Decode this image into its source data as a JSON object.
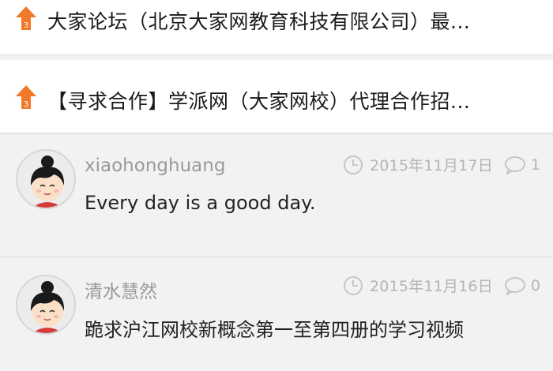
{
  "topics": [
    {
      "title": "大家论坛（北京大家网教育科技有限公司）最...",
      "rank": "3"
    },
    {
      "title": "【寻求合作】学派网（大家网校）代理合作招...",
      "rank": "3"
    }
  ],
  "posts": [
    {
      "username": "xiaohonghuang",
      "date": "2015年11月17日",
      "comments": "1",
      "content": "Every day is a good day."
    },
    {
      "username": "清水慧然",
      "date": "2015年11月16日",
      "comments": "0",
      "content": "跪求沪江网校新概念第一至第四册的学习视频"
    }
  ],
  "colors": {
    "accent": "#f07a2a",
    "muted": "#b4b4b4",
    "username": "#9a9a9a"
  },
  "icons": [
    "rank-up-arrow-icon",
    "clock-icon",
    "comment-icon",
    "avatar-girl-icon"
  ]
}
